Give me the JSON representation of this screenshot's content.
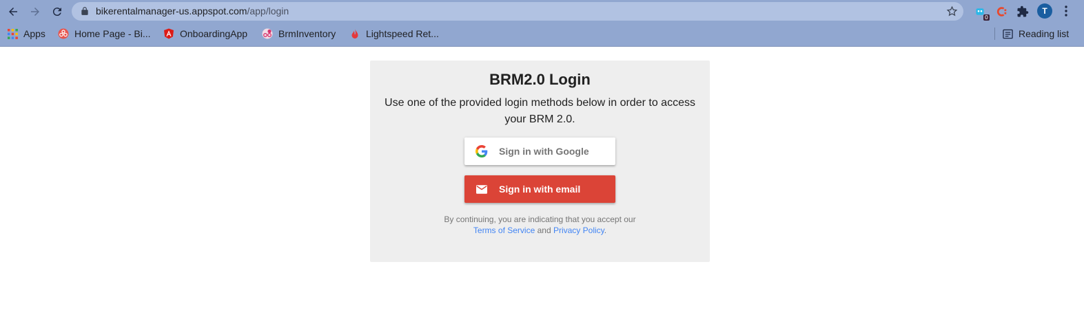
{
  "browser": {
    "url_host": "bikerentalmanager-us.appspot.com",
    "url_path": "/app/login",
    "extension_badge": "0",
    "profile_initial": "T",
    "bookmarks": [
      {
        "label": "Apps",
        "icon": "apps-grid-icon"
      },
      {
        "label": "Home Page - Bi...",
        "icon": "bike-icon"
      },
      {
        "label": "OnboardingApp",
        "icon": "angular-icon"
      },
      {
        "label": "BrmInventory",
        "icon": "bike-badge-icon"
      },
      {
        "label": "Lightspeed Ret...",
        "icon": "flame-icon"
      }
    ],
    "reading_list": "Reading list"
  },
  "login": {
    "title": "BRM2.0 Login",
    "subtitle": "Use one of the provided login methods below in order to access your BRM 2.0.",
    "google_button": "Sign in with Google",
    "email_button": "Sign in with email",
    "tos_prefix": "By continuing, you are indicating that you accept our",
    "tos_link": "Terms of Service",
    "tos_and": "and",
    "privacy_link": "Privacy Policy",
    "tos_suffix": "."
  },
  "colors": {
    "chrome_bg": "#91a7d0",
    "card_bg": "#eeeeee",
    "email_red": "#db4437",
    "link_blue": "#4285f4"
  }
}
